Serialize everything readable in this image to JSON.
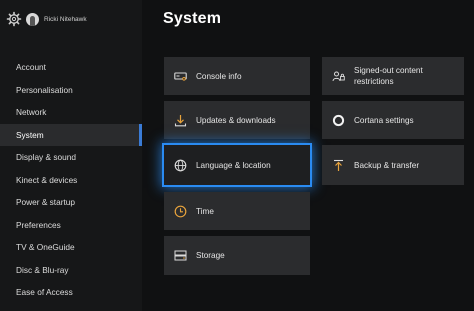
{
  "user": {
    "name": "Ricki Nitehawk"
  },
  "sidebar": {
    "items": [
      {
        "label": "Account"
      },
      {
        "label": "Personalisation"
      },
      {
        "label": "Network"
      },
      {
        "label": "System"
      },
      {
        "label": "Display & sound"
      },
      {
        "label": "Kinect & devices"
      },
      {
        "label": "Power & startup"
      },
      {
        "label": "Preferences"
      },
      {
        "label": "TV & OneGuide"
      },
      {
        "label": "Disc & Blu-ray"
      },
      {
        "label": "Ease of Access"
      }
    ],
    "selected": "System"
  },
  "main": {
    "title": "System",
    "tiles": [
      {
        "label": "Console info",
        "icon": "console-icon"
      },
      {
        "label": "Updates & downloads",
        "icon": "download-icon"
      },
      {
        "label": "Language & location",
        "icon": "globe-icon",
        "focused": true
      },
      {
        "label": "Time",
        "icon": "clock-icon"
      },
      {
        "label": "Storage",
        "icon": "storage-icon"
      },
      {
        "label": "Signed-out content restrictions",
        "icon": "people-lock-icon"
      },
      {
        "label": "Cortana settings",
        "icon": "cortana-icon"
      },
      {
        "label": "Backup & transfer",
        "icon": "upload-icon"
      }
    ]
  },
  "colors": {
    "background": "#101112",
    "sidebar": "#161718",
    "tile": "#2b2c2e",
    "focus": "#2a8bf2",
    "accent_orange": "#e8a33c",
    "selected_bar": "#3a7bd5"
  }
}
